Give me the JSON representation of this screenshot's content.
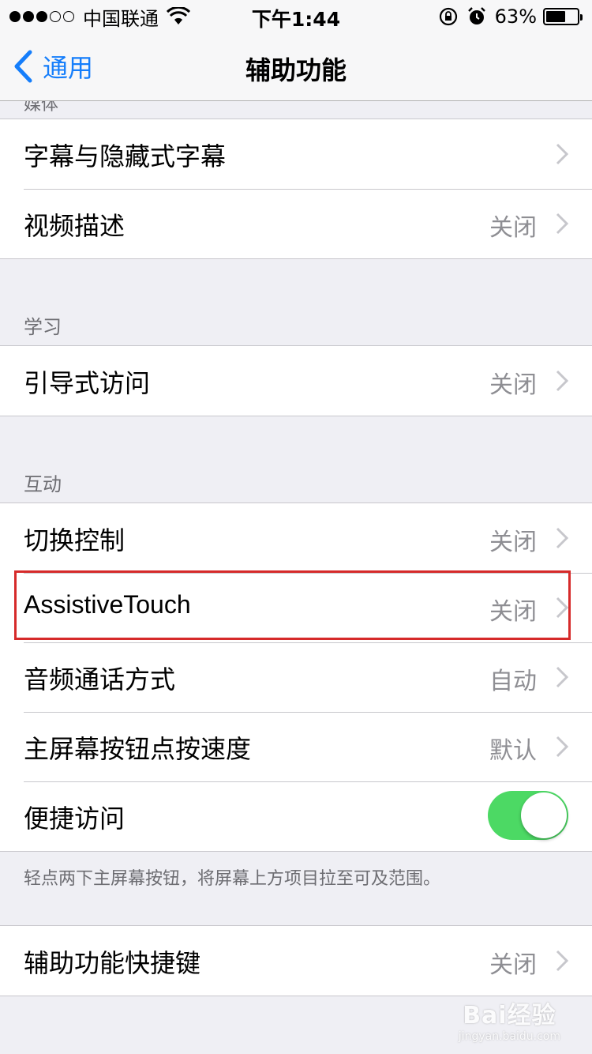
{
  "status_bar": {
    "carrier": "中国联通",
    "time": "下午1:44",
    "battery_percent": "63%",
    "battery_level": 0.63,
    "signal_bars_filled": 3,
    "signal_bars_total": 5
  },
  "nav": {
    "back_label": "通用",
    "title": "辅助功能"
  },
  "sections": {
    "partial_header": "媒体",
    "media_items": [
      {
        "label": "字幕与隐藏式字幕",
        "value": ""
      },
      {
        "label": "视频描述",
        "value": "关闭"
      }
    ],
    "learning_header": "学习",
    "learning_items": [
      {
        "label": "引导式访问",
        "value": "关闭"
      }
    ],
    "interaction_header": "互动",
    "interaction_items": [
      {
        "label": "切换控制",
        "value": "关闭"
      },
      {
        "label": "AssistiveTouch",
        "value": "关闭"
      },
      {
        "label": "音频通话方式",
        "value": "自动"
      },
      {
        "label": "主屏幕按钮点按速度",
        "value": "默认"
      },
      {
        "label": "便捷访问",
        "toggle_on": true
      }
    ],
    "interaction_footer": "轻点两下主屏幕按钮，将屏幕上方项目拉至可及范围。",
    "shortcut_items": [
      {
        "label": "辅助功能快捷键",
        "value": "关闭"
      }
    ]
  },
  "watermark": {
    "logo": "Bai经验",
    "url": "jingyan.baidu.com"
  },
  "colors": {
    "accent": "#157efb",
    "toggle_on": "#4cd964",
    "highlight": "#d62a2a"
  }
}
